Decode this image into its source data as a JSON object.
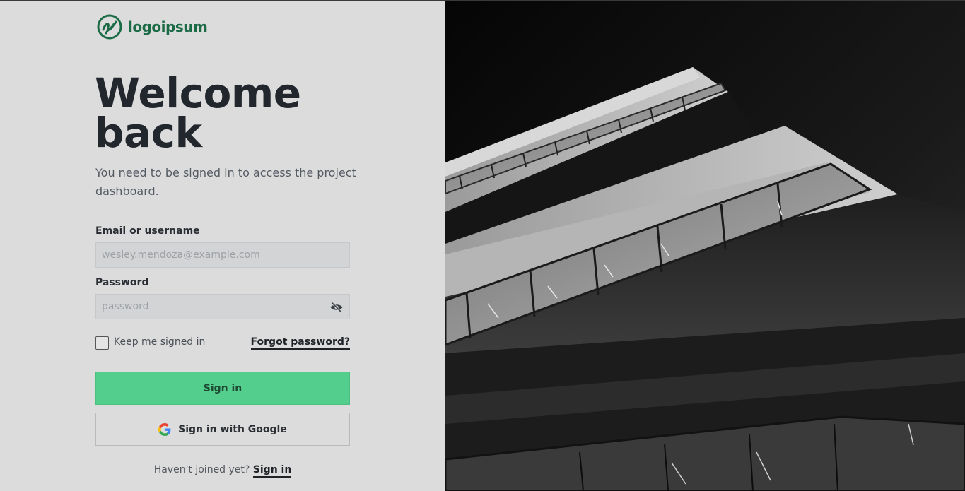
{
  "brand": {
    "name": "logoipsum",
    "color": "#1c6b47"
  },
  "heading": {
    "line1": "Welcome",
    "line2": "back"
  },
  "subtitle": "You need to be signed in to access the project dashboard.",
  "form": {
    "email_label": "Email or username",
    "email_placeholder": "wesley.mendoza@example.com",
    "password_label": "Password",
    "password_placeholder": "password",
    "password_toggle_icon": "eye-off-icon",
    "keep_signed_in_label": "Keep me signed in",
    "keep_signed_in_checked": false,
    "forgot_password_label": "Forgot password?",
    "sign_in_label": "Sign in",
    "sign_in_color": "#54ce8c",
    "google_label": "Sign in with Google",
    "google_icon": "google-icon"
  },
  "footer": {
    "prompt": "Haven't joined yet?",
    "link_label": "Sign in"
  },
  "hero_image": {
    "icon": "building-photo"
  }
}
